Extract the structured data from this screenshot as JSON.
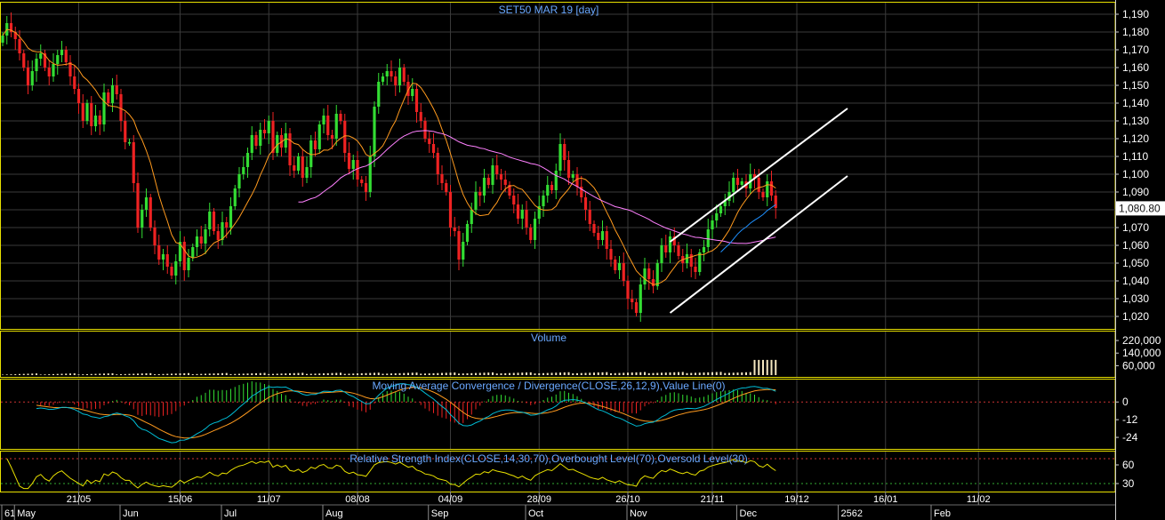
{
  "chart_data": [
    {
      "type": "candlestick",
      "title": "SET50 MAR 19   [day]",
      "ylim": [
        1015,
        1195
      ],
      "y_ticks": [
        1020,
        1030,
        1040,
        1050,
        1060,
        1070,
        1080,
        1090,
        1100,
        1110,
        1120,
        1130,
        1140,
        1150,
        1160,
        1170,
        1180,
        1190
      ],
      "y_tick_labels": [
        "1,020",
        "1,030",
        "1,040",
        "1,050",
        "1,060",
        "1,070",
        "1,080",
        "1,090",
        "1,100",
        "1,110",
        "1,120",
        "1,130",
        "1,140",
        "1,150",
        "1,160",
        "1,170",
        "1,180",
        "1,190"
      ],
      "last_price": 1080.8,
      "last_price_label": "1,080.80",
      "close": [
        1178,
        1185,
        1180,
        1176,
        1168,
        1160,
        1150,
        1158,
        1165,
        1168,
        1160,
        1155,
        1162,
        1167,
        1170,
        1163,
        1155,
        1148,
        1140,
        1130,
        1140,
        1127,
        1133,
        1128,
        1146,
        1140,
        1150,
        1145,
        1130,
        1118,
        1118,
        1095,
        1070,
        1080,
        1087,
        1070,
        1060,
        1052,
        1055,
        1048,
        1043,
        1051,
        1062,
        1046,
        1053,
        1059,
        1065,
        1061,
        1069,
        1079,
        1068,
        1063,
        1073,
        1070,
        1082,
        1092,
        1100,
        1104,
        1112,
        1122,
        1116,
        1125,
        1123,
        1130,
        1112,
        1122,
        1115,
        1123,
        1105,
        1102,
        1110,
        1098,
        1104,
        1119,
        1114,
        1128,
        1133,
        1122,
        1120,
        1134,
        1130,
        1112,
        1103,
        1108,
        1097,
        1095,
        1090,
        1110,
        1138,
        1152,
        1155,
        1158,
        1155,
        1150,
        1160,
        1152,
        1144,
        1148,
        1135,
        1130,
        1120,
        1117,
        1112,
        1100,
        1095,
        1090,
        1070,
        1068,
        1052,
        1062,
        1072,
        1080,
        1090,
        1088,
        1098,
        1094,
        1105,
        1100,
        1097,
        1094,
        1088,
        1083,
        1075,
        1080,
        1070,
        1063,
        1075,
        1082,
        1088,
        1094,
        1091,
        1102,
        1117,
        1108,
        1098,
        1100,
        1093,
        1087,
        1080,
        1072,
        1067,
        1063,
        1068,
        1058,
        1052,
        1046,
        1050,
        1040,
        1030,
        1028,
        1022,
        1038,
        1047,
        1041,
        1037,
        1050,
        1060,
        1056,
        1065,
        1060,
        1054,
        1050,
        1055,
        1048,
        1045,
        1056,
        1059,
        1069,
        1074,
        1078,
        1082,
        1085,
        1090,
        1098,
        1094,
        1096,
        1092,
        1100,
        1098,
        1090,
        1087,
        1096,
        1088,
        1081
      ],
      "overlays": [
        {
          "name": "ma-fast",
          "color": "#ff9a1e",
          "period": 10
        },
        {
          "name": "ma-slow",
          "color": "#ff80ff",
          "period": 40,
          "start": 70
        },
        {
          "name": "ma-blue",
          "color": "#1e90ff",
          "period": 20,
          "start": 170
        }
      ],
      "trend_channel": {
        "color": "#ffffff",
        "upper": [
          [
            158,
            1062
          ],
          [
            200,
            1137
          ]
        ],
        "lower": [
          [
            158,
            1022
          ],
          [
            200,
            1099
          ]
        ]
      }
    },
    {
      "type": "bar",
      "title": "Volume",
      "ylim": [
        0,
        260000
      ],
      "y_ticks": [
        60000,
        140000,
        220000
      ],
      "y_tick_labels": [
        "60,000",
        "140,000",
        "220,000"
      ],
      "values_note": "low until late Dec, then large"
    },
    {
      "type": "line",
      "title": "Moving Average Convergence / Divergence(CLOSE,26,12,9),Value Line(0)",
      "ylim": [
        -30,
        14
      ],
      "y_ticks": [
        0,
        -12,
        -24
      ],
      "y_tick_labels": [
        "0",
        "-12",
        "-24"
      ]
    },
    {
      "type": "line",
      "title": "Relative Strength Index(CLOSE,14,30,70),Overbought Level(70),Oversold Level(30)",
      "ylim": [
        20,
        80
      ],
      "y_ticks": [
        60,
        30
      ],
      "y_tick_labels": [
        "60",
        "30"
      ],
      "levels": [
        70,
        30
      ]
    }
  ],
  "x_axis": {
    "dates": [
      {
        "i": 18,
        "label": "21/05"
      },
      {
        "i": 42,
        "label": "15/06"
      },
      {
        "i": 63,
        "label": "11/07"
      },
      {
        "i": 84,
        "label": "08/08"
      },
      {
        "i": 106,
        "label": "04/09"
      },
      {
        "i": 127,
        "label": "28/09"
      },
      {
        "i": 148,
        "label": "26/10"
      },
      {
        "i": 168,
        "label": "21/11"
      },
      {
        "i": 188,
        "label": "19/12"
      },
      {
        "i": 209,
        "label": "16/01"
      },
      {
        "i": 231,
        "label": "11/02"
      }
    ],
    "months": [
      {
        "i": 0,
        "label": "61"
      },
      {
        "i": 3,
        "label": "May"
      },
      {
        "i": 28,
        "label": "Jun"
      },
      {
        "i": 52,
        "label": "Jul"
      },
      {
        "i": 76,
        "label": "Aug"
      },
      {
        "i": 101,
        "label": "Sep"
      },
      {
        "i": 124,
        "label": "Oct"
      },
      {
        "i": 148,
        "label": "Nov"
      },
      {
        "i": 174,
        "label": "Dec"
      },
      {
        "i": 198,
        "label": "2562"
      },
      {
        "i": 220,
        "label": "Feb"
      }
    ]
  },
  "colors": {
    "bull": "#33dd33",
    "bear": "#ee2222",
    "grid": "#3a3a3a",
    "title": "#6aa8ff",
    "panel_border": "#e8e000",
    "macd_line": "#00bcd4",
    "macd_signal": "#ff9a1e",
    "rsi_line": "#e8e000",
    "volume_bar": "#f5e8c0"
  }
}
